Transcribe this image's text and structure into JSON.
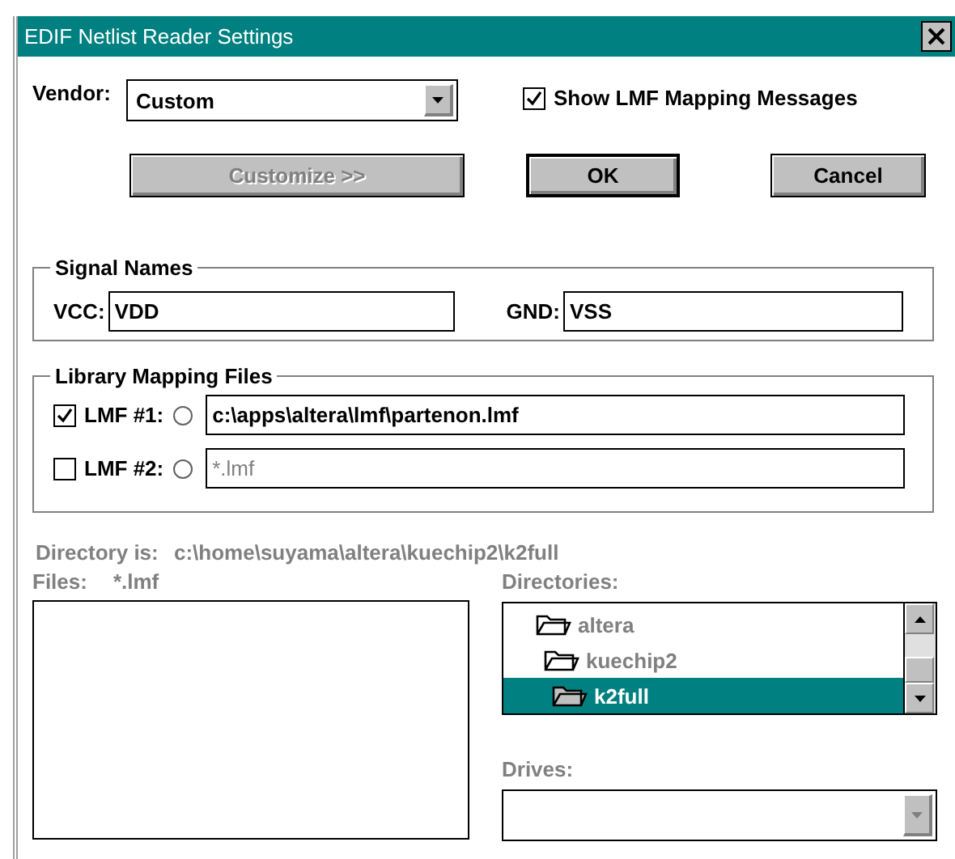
{
  "window": {
    "title": "EDIF Netlist Reader Settings"
  },
  "vendor": {
    "label": "Vendor:",
    "value": "Custom"
  },
  "show_mapping_messages": {
    "label": "Show LMF Mapping Messages",
    "checked": true
  },
  "buttons": [
    {
      "label": "Customize >>",
      "disabled": true,
      "default": false
    },
    {
      "label": "OK",
      "disabled": false,
      "default": true
    },
    {
      "label": "Cancel",
      "disabled": false,
      "default": false
    }
  ],
  "signal_names": {
    "title": "Signal Names",
    "fields": [
      {
        "label": "VCC:",
        "value": "VDD"
      },
      {
        "label": "GND:",
        "value": "VSS"
      }
    ]
  },
  "library_mapping_files": {
    "title": "Library Mapping Files",
    "rows": [
      {
        "label": "LMF #1:",
        "checked": true,
        "selected": false,
        "disabled": false,
        "value": "c:\\apps\\altera\\lmf\\partenon.lmf"
      },
      {
        "label": "LMF #2:",
        "checked": false,
        "selected": false,
        "disabled": true,
        "value": "*.lmf"
      }
    ]
  },
  "file_browser": {
    "disabled": true,
    "directory": {
      "label": "Directory is:",
      "path": "c:\\home\\suyama\\altera\\kuechip2\\k2full"
    },
    "files": {
      "label": "Files:",
      "filter": "*.lmf"
    },
    "directories": {
      "label": "Directories:",
      "items": [
        {
          "name": "altera",
          "selected": false,
          "children": [
            {
              "name": "kuechip2",
              "selected": false,
              "children": [
                {
                  "name": "k2full",
                  "selected": true
                }
              ]
            }
          ]
        }
      ]
    },
    "drives": {
      "label": "Drives:"
    }
  }
}
